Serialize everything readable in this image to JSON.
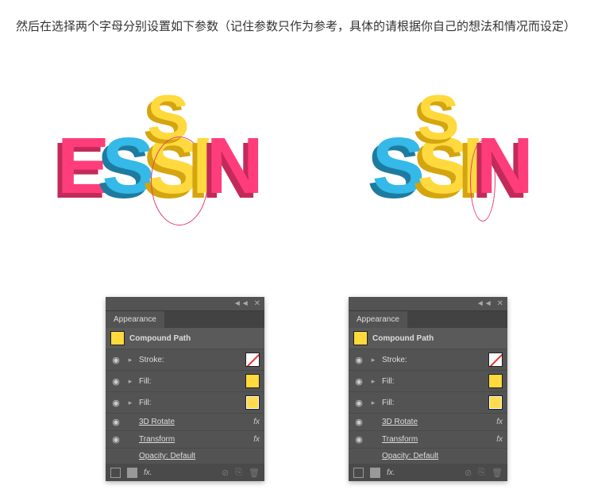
{
  "instruction": "然后在选择两个字母分别设置如下参数（记住参数只作为参考，具体的请根据你自己的想法和情况而设定）",
  "artwork": {
    "left_text": "ESSIN",
    "right_text": "SSIN"
  },
  "panel": {
    "tab": "Appearance",
    "title": "Compound Path",
    "stroke": "Stroke:",
    "fill": "Fill:",
    "effect1": "3D Rotate",
    "effect2": "Transform",
    "opacity": "Opacity:  Default",
    "fx": "fx",
    "fx_ftr": "fx."
  }
}
